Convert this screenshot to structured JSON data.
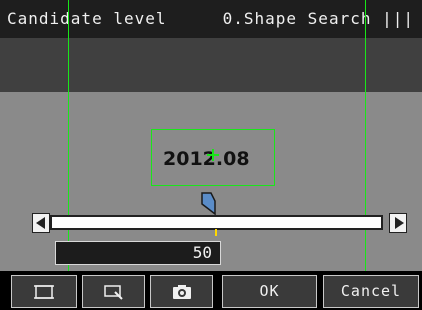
{
  "title": {
    "left": "Candidate level",
    "right": "0.Shape Search |||"
  },
  "measurement": {
    "value_label": "2012.08"
  },
  "slider": {
    "value": "50",
    "min": 0,
    "max": 100
  },
  "buttons": {
    "ok_label": "OK",
    "cancel_label": "Cancel",
    "icons": [
      "full-view-icon",
      "zoom-icon",
      "camera-icon"
    ]
  },
  "colors": {
    "guide_line": "#19e619",
    "title_bar": "#1e1e1e",
    "canvas": "#8a8a8a",
    "indicator": "#5a8cc8"
  }
}
